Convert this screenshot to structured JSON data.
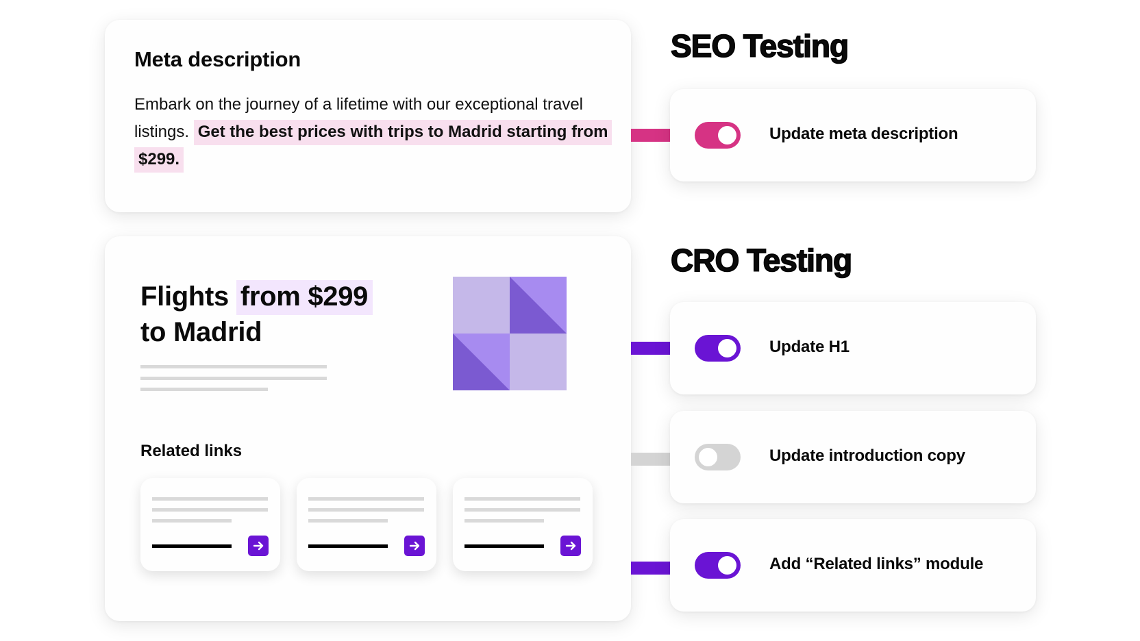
{
  "meta_card": {
    "title": "Meta description",
    "body_plain": "Embark on the journey of a lifetime with our exceptional travel listings. ",
    "body_highlight": "Get the best prices with trips to Madrid starting from $299.",
    "highlight_color": "#f8dfee"
  },
  "page_card": {
    "h1_plain": "Flights ",
    "h1_highlight": "from $299",
    "h1_line2": "to Madrid",
    "h1_highlight_color": "#f3e6fd",
    "related_title": "Related links",
    "related_cards": [
      {
        "arrow_icon": "arrow-right-icon"
      },
      {
        "arrow_icon": "arrow-right-icon"
      },
      {
        "arrow_icon": "arrow-right-icon"
      }
    ]
  },
  "seo": {
    "title": "SEO Testing",
    "items": [
      {
        "label": "Update meta description",
        "on": true,
        "color": "#d63384"
      }
    ]
  },
  "cro": {
    "title": "CRO Testing",
    "items": [
      {
        "label": "Update H1",
        "on": true,
        "color": "#6a14d4"
      },
      {
        "label": "Update introduction copy",
        "on": false,
        "color": "#d4d4d4"
      },
      {
        "label": "Add “Related links” module",
        "on": true,
        "color": "#6a14d4"
      }
    ]
  },
  "colors": {
    "seo_accent": "#d63384",
    "cro_accent": "#6a14d4",
    "off_gray": "#d4d4d4",
    "graphic_light": "#c5b8e9",
    "graphic_mid": "#a78bf0",
    "graphic_dark": "#7b5ad1"
  }
}
